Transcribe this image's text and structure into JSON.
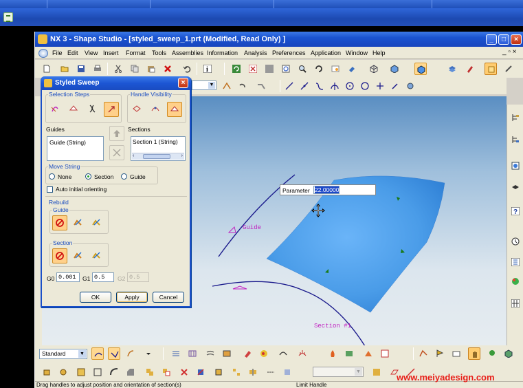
{
  "window": {
    "title": "NX 3 - Shape Studio - [styled_sweep_1.prt (Modified, Read Only) ]"
  },
  "menubar": {
    "items": [
      {
        "label": "File"
      },
      {
        "label": "Edit"
      },
      {
        "label": "View"
      },
      {
        "label": "Insert"
      },
      {
        "label": "Format"
      },
      {
        "label": "Tools"
      },
      {
        "label": "Assemblies"
      },
      {
        "label": "Information"
      },
      {
        "label": "Analysis"
      },
      {
        "label": "Preferences"
      },
      {
        "label": "Application"
      },
      {
        "label": "Window"
      },
      {
        "label": "Help"
      }
    ]
  },
  "dialog": {
    "title": "Styled Sweep",
    "selection_steps_label": "Selection Steps",
    "handle_visibility_label": "Handle Visibility",
    "guides_label": "Guides",
    "sections_label": "Sections",
    "guides_list": [
      "Guide (String)"
    ],
    "sections_list": [
      "Section 1 (String)"
    ],
    "move_string_label": "Move String",
    "move_options": [
      "None",
      "Section",
      "Guide"
    ],
    "move_selected": "Section",
    "auto_orient_label": "Auto initial orienting",
    "rebuild_label": "Rebuild",
    "rebuild_guide_label": "Guide",
    "rebuild_section_label": "Section",
    "g0_label": "G0",
    "g0_value": "0.001",
    "g1_label": "G1",
    "g1_value": "0.5",
    "g2_label": "G2",
    "g2_value": "0.5",
    "ok_label": "OK",
    "apply_label": "Apply",
    "cancel_label": "Cancel"
  },
  "toolbar": {
    "role_dropdown": "Standard"
  },
  "graphics": {
    "parameter_label": "Parameter",
    "parameter_value": "22.00000",
    "guide_label": "Guide",
    "section_label": "Section #1"
  },
  "statusbar": {
    "prompt": "Drag handles to adjust position and orientation of section(s)",
    "status": "Limit Handle"
  },
  "watermark": "www.meiyadesign.com",
  "colors": {
    "title_bar": "#1a53d0",
    "surface": "#5aa8f0",
    "curve": "#1a1a8c",
    "annotation": "#c020c0",
    "handle": "#1a7a1a",
    "watermark": "#e8201a"
  }
}
